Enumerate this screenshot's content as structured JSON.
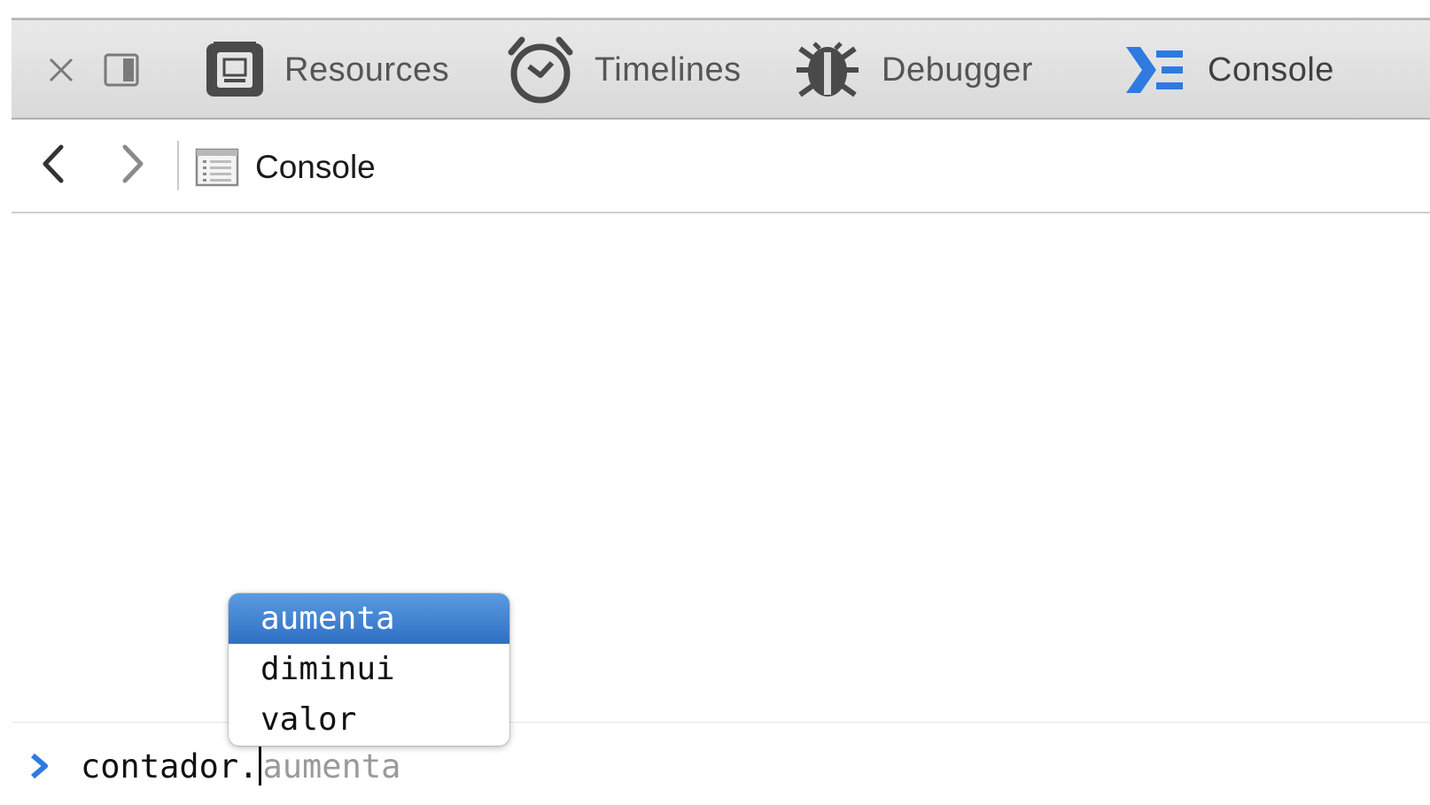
{
  "toolbar": {
    "close_icon": "close-icon",
    "dock_icon": "dock-toggle-icon",
    "tabs": [
      {
        "label": "Resources",
        "icon": "resources-icon"
      },
      {
        "label": "Timelines",
        "icon": "timelines-icon"
      },
      {
        "label": "Debugger",
        "icon": "debugger-icon"
      },
      {
        "label": "Console",
        "icon": "console-icon",
        "active": true
      }
    ]
  },
  "navbar": {
    "back_icon": "chevron-left-icon",
    "forward_icon": "chevron-right-icon",
    "breadcrumb_icon": "log-icon",
    "breadcrumb_label": "Console"
  },
  "console": {
    "prompt_icon": "prompt-chevron-icon",
    "input_text": "contador.",
    "completion_hint": "aumenta",
    "autocomplete": {
      "items": [
        "aumenta",
        "diminui",
        "valor"
      ],
      "selected_index": 0
    }
  },
  "colors": {
    "accent": "#2f7ae0",
    "selected_bg": "#3f82d2",
    "toolbar_bg": "#e0e0e0",
    "hint_text": "#9a9a9a"
  }
}
